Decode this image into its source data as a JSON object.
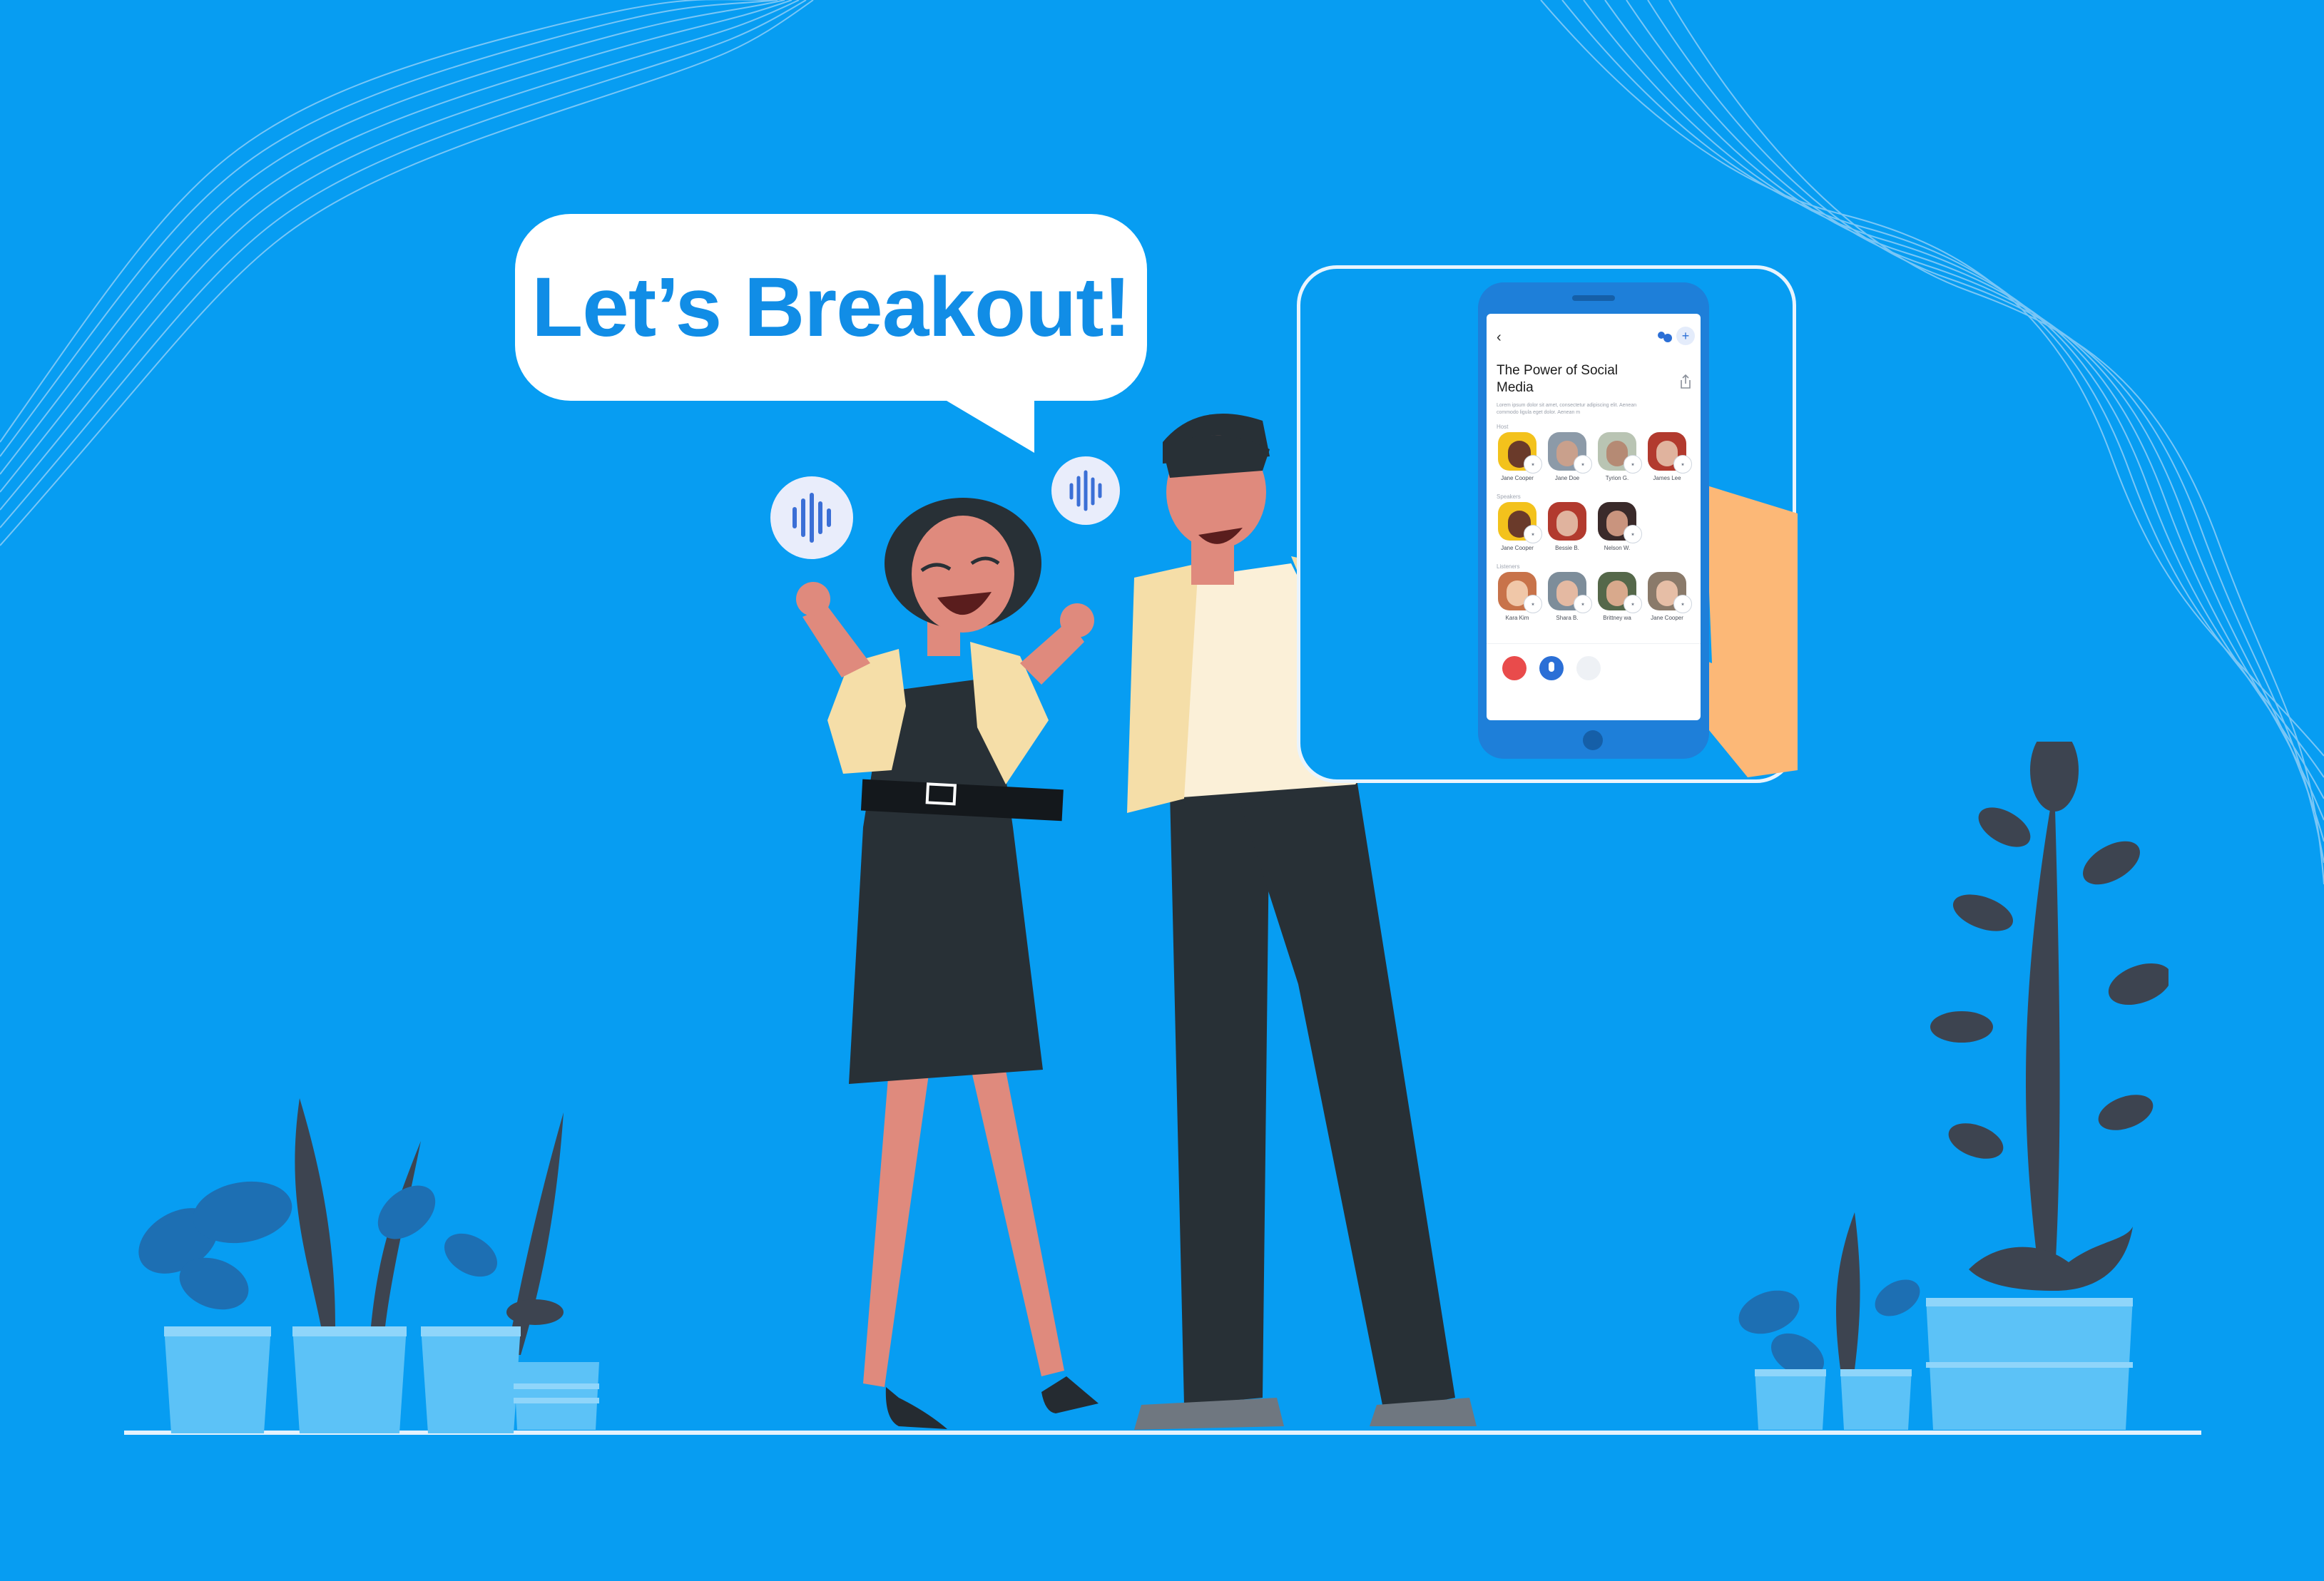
{
  "speech_bubble": {
    "text": "Let’s Breakout!"
  },
  "phone_screen": {
    "back_icon": "chevron-left-icon",
    "people_icon": "people-icon",
    "add_icon": "plus-icon",
    "share_icon": "share-icon",
    "room_title_line1": "The Power of Social",
    "room_title_line2": "Media",
    "description_line1": "Lorem ipsum dolor sit amet, consectetur adipiscing elit. Aenean",
    "description_line2": "commodo ligula eget dolor. Aenean m",
    "sections": [
      {
        "label": "Host",
        "people": [
          "Jane Cooper",
          "Jane Doe",
          "Tyrion G.",
          "James Lee"
        ]
      },
      {
        "label": "Speakers",
        "people": [
          "Jane Cooper",
          "Bessie B.",
          "Nelson W."
        ]
      },
      {
        "label": "Listeners",
        "people": [
          "Kara Kim",
          "Shara B.",
          "Brittney wa",
          "Jane Cooper"
        ]
      }
    ],
    "controls": {
      "leave_icon": "leave-icon",
      "mic_icon": "mic-icon",
      "speaker_icon": "speaker-icon"
    }
  },
  "colors": {
    "background": "#079df2",
    "accent": "#118de6",
    "phone_body": "#1e7fd9",
    "leave_button": "#e94b4b",
    "mic_button": "#2b6fd6",
    "plant_dark": "#3d4450",
    "plant_light": "#5cc2f7"
  }
}
